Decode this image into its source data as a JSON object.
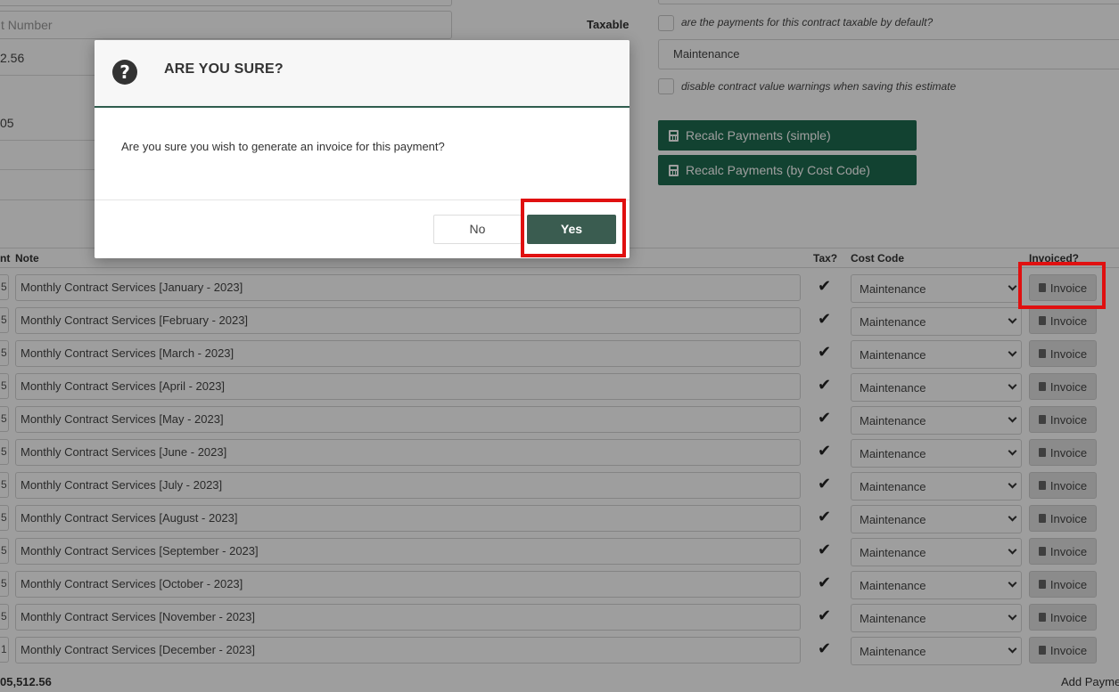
{
  "form": {
    "number_placeholder": "t Number",
    "value_partial_1": "2.56",
    "value_partial_2": "05",
    "taxable_label": "Taxable",
    "taxable_note": "are the payments for this contract taxable by default?",
    "cost_code_value": "Maintenance",
    "warnings_note": "disable contract value warnings when saving this estimate",
    "recalc_simple_label": "Recalc Payments (simple)",
    "recalc_costcode_label": "Recalc Payments (by Cost Code)"
  },
  "table": {
    "headers": {
      "amount": "nt",
      "note": "Note",
      "tax": "Tax?",
      "cost_code": "Cost Code",
      "invoiced": "Invoiced?"
    },
    "invoice_label": "Invoice",
    "check_glyph": "✔",
    "rows": [
      {
        "amount": "5",
        "note": "Monthly Contract Services [January - 2023]",
        "cost_code": "Maintenance"
      },
      {
        "amount": "5",
        "note": "Monthly Contract Services [February - 2023]",
        "cost_code": "Maintenance"
      },
      {
        "amount": "5",
        "note": "Monthly Contract Services [March - 2023]",
        "cost_code": "Maintenance"
      },
      {
        "amount": "5",
        "note": "Monthly Contract Services [April - 2023]",
        "cost_code": "Maintenance"
      },
      {
        "amount": "5",
        "note": "Monthly Contract Services [May - 2023]",
        "cost_code": "Maintenance"
      },
      {
        "amount": "5",
        "note": "Monthly Contract Services [June - 2023]",
        "cost_code": "Maintenance"
      },
      {
        "amount": "5",
        "note": "Monthly Contract Services [July - 2023]",
        "cost_code": "Maintenance"
      },
      {
        "amount": "5",
        "note": "Monthly Contract Services [August - 2023]",
        "cost_code": "Maintenance"
      },
      {
        "amount": "5",
        "note": "Monthly Contract Services [September - 2023]",
        "cost_code": "Maintenance"
      },
      {
        "amount": "5",
        "note": "Monthly Contract Services [October - 2023]",
        "cost_code": "Maintenance"
      },
      {
        "amount": "5",
        "note": "Monthly Contract Services [November - 2023]",
        "cost_code": "Maintenance"
      },
      {
        "amount": "1",
        "note": "Monthly Contract Services [December - 2023]",
        "cost_code": "Maintenance"
      }
    ],
    "total": "05,512.56",
    "add_payment_label": "Add Payme"
  },
  "modal": {
    "icon": "question-circle-icon",
    "icon_glyph": "?",
    "title": "ARE YOU SURE?",
    "message": "Are you sure you wish to generate an invoice for this payment?",
    "no_label": "No",
    "yes_label": "Yes"
  },
  "colors": {
    "primary_green": "#1e6b4f",
    "yes_button": "#3a5c50",
    "highlight": "#e01010"
  }
}
